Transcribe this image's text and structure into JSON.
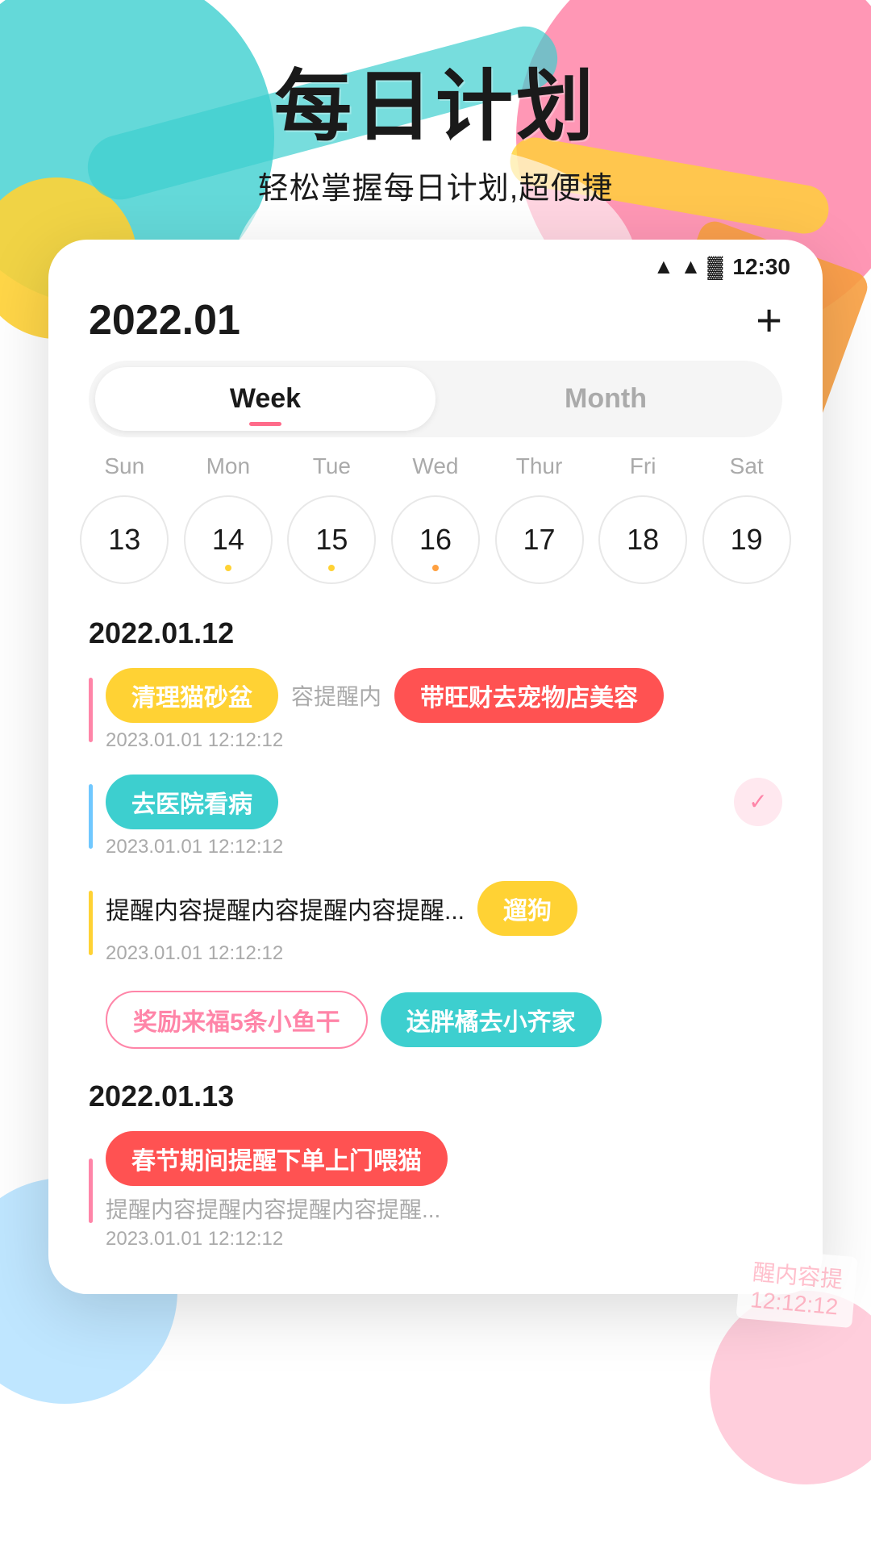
{
  "app": {
    "title": "每日计划",
    "subtitle": "轻松掌握每日计划,超便捷"
  },
  "statusBar": {
    "time": "12:30",
    "wifi": "▲",
    "signal": "▲",
    "battery": "▓"
  },
  "calendar": {
    "currentDate": "2022.01",
    "addButton": "+",
    "tabs": [
      {
        "label": "Week",
        "active": true
      },
      {
        "label": "Month",
        "active": false
      }
    ],
    "dayLabels": [
      "Sun",
      "Mon",
      "Tue",
      "Wed",
      "Thur",
      "Fri",
      "Sat"
    ],
    "dates": [
      {
        "num": "13",
        "dot": null
      },
      {
        "num": "14",
        "dot": "yellow"
      },
      {
        "num": "15",
        "dot": "yellow"
      },
      {
        "num": "16",
        "dot": "orange"
      },
      {
        "num": "17",
        "dot": null
      },
      {
        "num": "18",
        "dot": null
      },
      {
        "num": "19",
        "dot": null
      }
    ]
  },
  "sections": [
    {
      "date": "2022.01.12",
      "tasks": [
        {
          "id": 1,
          "lineColor": "pink",
          "tagText": "清理猫砂盆",
          "tagStyle": "yellow",
          "reminderText": "容提醒内",
          "time": "2023.01.01   12:12:12",
          "extraTag": "带旺财去宠物店美容",
          "extraTagStyle": "red"
        },
        {
          "id": 2,
          "lineColor": "blue",
          "tagText": "去医院看病",
          "tagStyle": "teal",
          "time": "2023.01.01   12:12:12",
          "hasCheck": true
        },
        {
          "id": 3,
          "lineColor": "yellow",
          "bodyText": "提醒内容提醒内容提醒内容提醒...",
          "time": "2023.01.01   12:12:12",
          "extraTag": "遛狗",
          "extraTagStyle": "yellow"
        },
        {
          "id": 4,
          "tagText": "奖励来福5条小鱼干",
          "tagStyle": "pink-outline",
          "extraTag": "送胖橘去小齐家",
          "extraTagStyle": "teal"
        }
      ]
    },
    {
      "date": "2022.01.13",
      "tasks": [
        {
          "id": 5,
          "lineColor": "pink",
          "tagText": "春节期间提醒下单上门喂猫",
          "tagStyle": "red",
          "bodyText": "提醒内容提醒内容提醒内容提醒...",
          "time": "2023.01.01   12:12:12"
        }
      ]
    }
  ]
}
